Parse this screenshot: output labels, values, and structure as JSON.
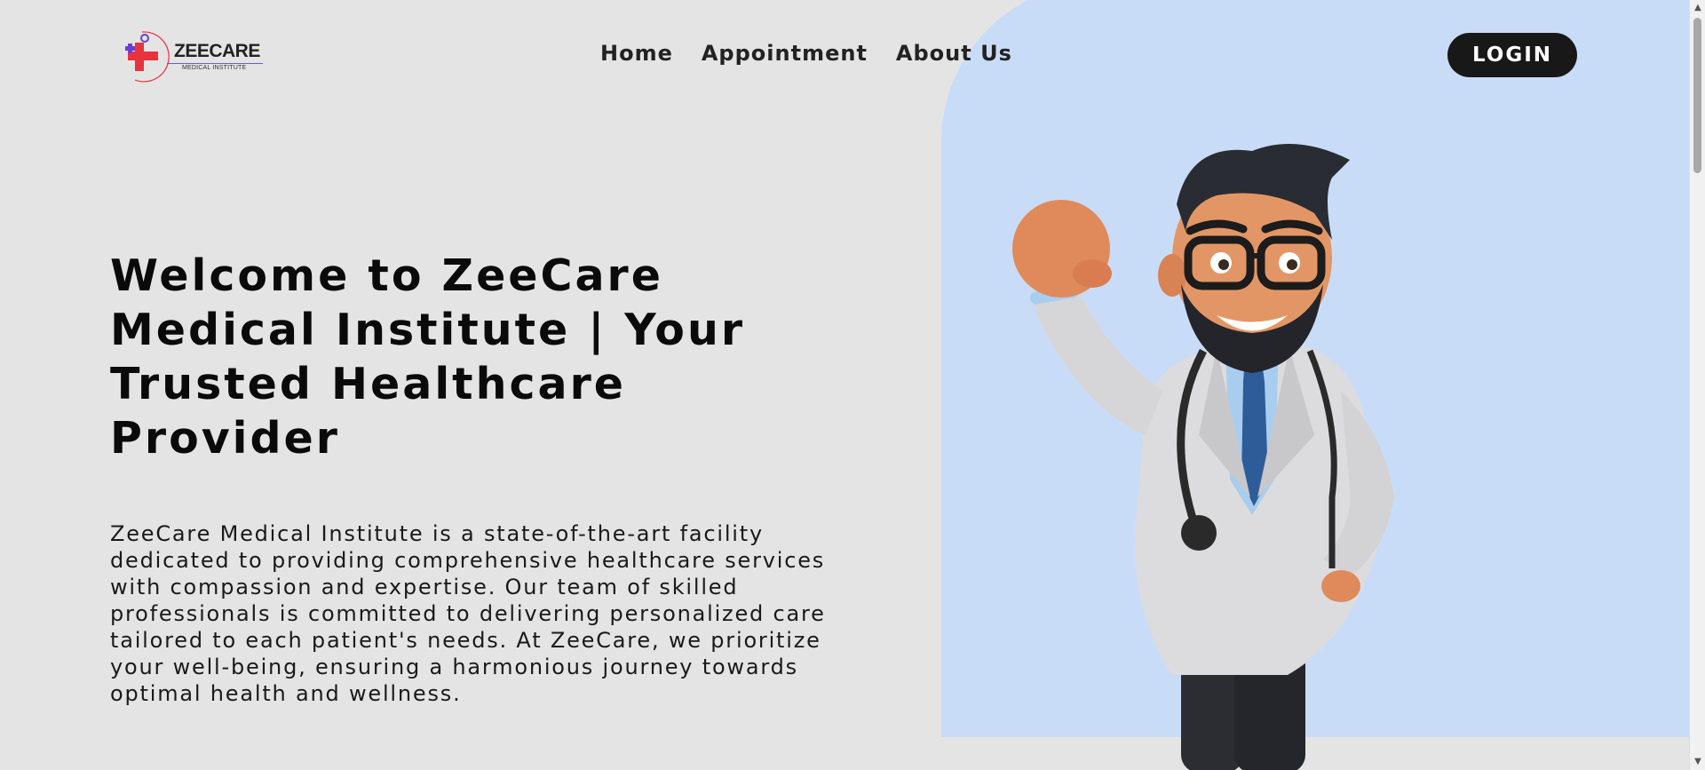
{
  "brand": {
    "name": "ZEECARE",
    "subtitle": "MEDICAL INSTITUTE"
  },
  "nav": {
    "items": [
      "Home",
      "Appointment",
      "About Us"
    ],
    "login_label": "LOGIN"
  },
  "hero": {
    "title": "Welcome to ZeeCare Medical Institute | Your Trusted Healthcare Provider",
    "description": "ZeeCare Medical Institute is a state-of-the-art facility dedicated to providing comprehensive healthcare services with compassion and expertise. Our team of skilled professionals is committed to delivering personalized care tailored to each patient's needs. At ZeeCare, we prioritize your well-being, ensuring a harmonious journey towards optimal health and wellness.",
    "image_icon": "doctor-illustration"
  },
  "colors": {
    "background": "#e4e4e4",
    "accent_blob": "#c9dcf7",
    "button": "#181818",
    "logo_red": "#e8323c",
    "logo_purple": "#6a3fd0"
  }
}
